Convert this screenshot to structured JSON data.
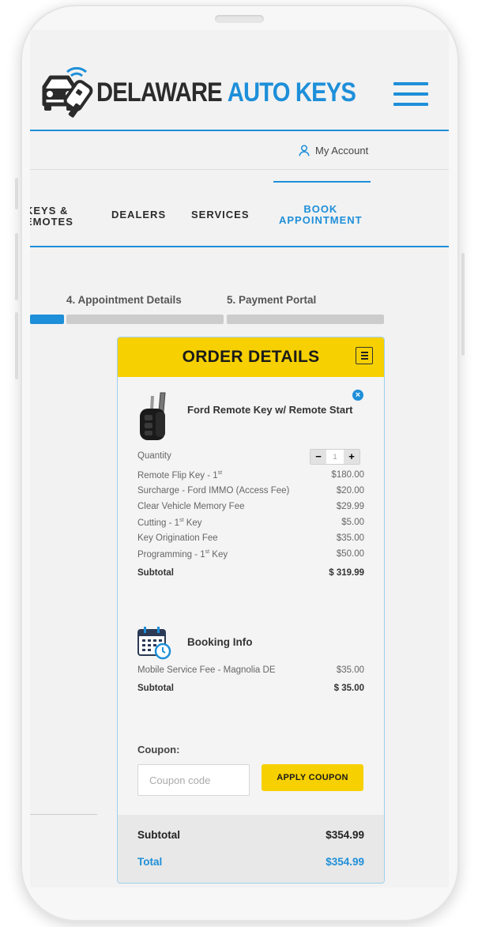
{
  "header": {
    "logo_text_a": "DELAWARE",
    "logo_text_b": "AUTO KEYS",
    "account_label": "My Account"
  },
  "nav": {
    "items": [
      {
        "line1": "KEYS &",
        "line2": "EMOTES"
      },
      {
        "line1": "DEALERS"
      },
      {
        "line1": "SERVICES"
      },
      {
        "line1": "BOOK",
        "line2": "APPOINTMENT"
      }
    ]
  },
  "steps": {
    "step4": "4. Appointment Details",
    "step5": "5. Payment Portal"
  },
  "order": {
    "title": "ORDER DETAILS",
    "product_name": "Ford Remote Key w/ Remote Start",
    "quantity_label": "Quantity",
    "quantity_value": "1",
    "line_items": [
      {
        "label": "Remote Flip Key - 1",
        "sup": "st",
        "amount": "$180.00"
      },
      {
        "label": "Surcharge - Ford IMMO (Access Fee)",
        "amount": "$20.00"
      },
      {
        "label": "Clear Vehicle Memory Fee",
        "amount": "$29.99"
      },
      {
        "label": "Cutting - 1",
        "sup": "st",
        "label_suffix": " Key",
        "amount": "$5.00"
      },
      {
        "label": "Key Origination Fee",
        "amount": "$35.00"
      },
      {
        "label": "Programming - 1",
        "sup": "st",
        "label_suffix": " Key",
        "amount": "$50.00"
      }
    ],
    "subtotal_label": "Subtotal",
    "subtotal_value": "$ 319.99",
    "booking_title": "Booking Info",
    "booking_items": [
      {
        "label": "Mobile Service Fee - Magnolia DE",
        "amount": "$35.00"
      }
    ],
    "booking_subtotal_label": "Subtotal",
    "booking_subtotal_value": "$ 35.00",
    "coupon_label": "Coupon:",
    "coupon_placeholder": "Coupon code",
    "coupon_button": "APPLY COUPON",
    "totals_subtotal_label": "Subtotal",
    "totals_subtotal_value": "$354.99",
    "totals_total_label": "Total",
    "totals_total_value": "$354.99"
  },
  "colors": {
    "brand_blue": "#1e8fd9",
    "accent_yellow": "#f6d000"
  }
}
